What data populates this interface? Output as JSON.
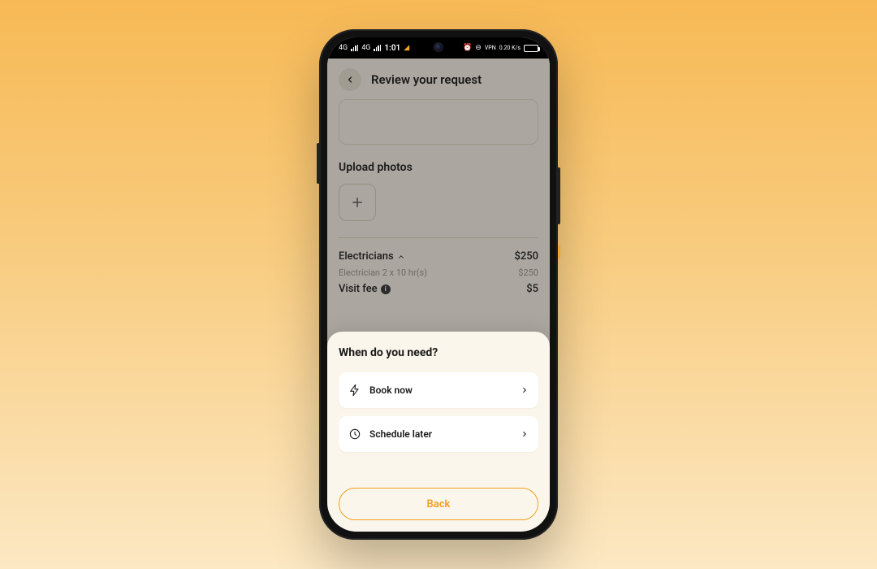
{
  "statusbar": {
    "net_label": "4G",
    "time": "1:01",
    "right_label_1": "VPN",
    "right_label_2": "0.20 K/s"
  },
  "header": {
    "title": "Review your request"
  },
  "upload": {
    "label": "Upload photos"
  },
  "summary": {
    "category_label": "Electricians",
    "category_price": "$250",
    "line_item_label": "Electrician 2 x  10 hr(s)",
    "line_item_price": "$250",
    "visit_fee_label": "Visit fee",
    "visit_fee_price": "$5"
  },
  "sheet": {
    "title": "When do you need?",
    "option1": "Book now",
    "option2": "Schedule later",
    "back": "Back"
  },
  "colors": {
    "accent": "#f0a020"
  }
}
